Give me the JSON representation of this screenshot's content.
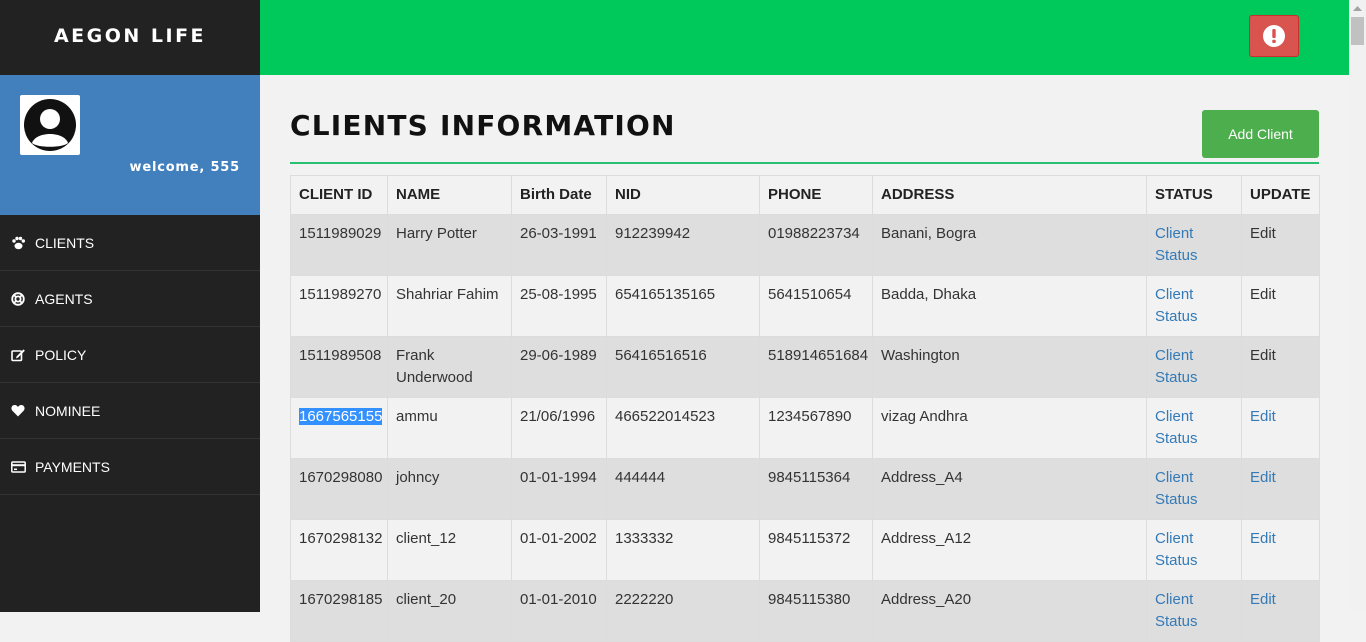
{
  "sidebar": {
    "brand": "AEGON LIFE",
    "welcome": "welcome, 555",
    "items": [
      {
        "label": "CLIENTS",
        "icon": "paw-icon"
      },
      {
        "label": "AGENTS",
        "icon": "lifebuoy-icon"
      },
      {
        "label": "POLICY",
        "icon": "edit-icon"
      },
      {
        "label": "NOMINEE",
        "icon": "heart-icon"
      },
      {
        "label": "PAYMENTS",
        "icon": "credit-card-icon"
      }
    ]
  },
  "topbar": {
    "alert_icon": "exclamation-circle-icon"
  },
  "main": {
    "title": "CLIENTS INFORMATION",
    "add_client_label": "Add Client"
  },
  "table": {
    "headers": [
      "CLIENT ID",
      "NAME",
      "Birth Date",
      "NID",
      "PHONE",
      "ADDRESS",
      "STATUS",
      "UPDATE"
    ],
    "rows": [
      {
        "id": "1511989029",
        "name": "Harry Potter",
        "birth": "26-03-1991",
        "nid": "912239942",
        "phone": "01988223734",
        "address": "Banani, Bogra",
        "status": "Client Status",
        "update": "Edit"
      },
      {
        "id": "1511989270",
        "name": "Shahriar Fahim",
        "birth": "25-08-1995",
        "nid": "654165135165",
        "phone": "5641510654",
        "address": "Badda, Dhaka",
        "status": "Client Status",
        "update": "Edit"
      },
      {
        "id": "1511989508",
        "name": "Frank Underwood",
        "birth": "29-06-1989",
        "nid": "56416516516",
        "phone": "518914651684",
        "address": "Washington",
        "status": "Client Status",
        "update": "Edit"
      },
      {
        "id": "1667565155",
        "name": "ammu",
        "birth": "21/06/1996",
        "nid": "466522014523",
        "phone": "1234567890",
        "address": "vizag Andhra",
        "status": "Client Status",
        "update": "Edit"
      },
      {
        "id": "1670298080",
        "name": "johncy",
        "birth": "01-01-1994",
        "nid": "444444",
        "phone": "9845115364",
        "address": "Address_A4",
        "status": "Client Status",
        "update": "Edit"
      },
      {
        "id": "1670298132",
        "name": "client_12",
        "birth": "01-01-2002",
        "nid": "1333332",
        "phone": "9845115372",
        "address": "Address_A12",
        "status": "Client Status",
        "update": "Edit"
      },
      {
        "id": "1670298185",
        "name": "client_20",
        "birth": "01-01-2010",
        "nid": "2222220",
        "phone": "9845115380",
        "address": "Address_A20",
        "status": "Client Status",
        "update": "Edit"
      }
    ]
  },
  "colors": {
    "topbar": "#00c95b",
    "sidebar": "#222222",
    "profile": "#4280bd",
    "add_button": "#4cae4c",
    "alert_button": "#d9534f",
    "link": "#337ab7"
  }
}
